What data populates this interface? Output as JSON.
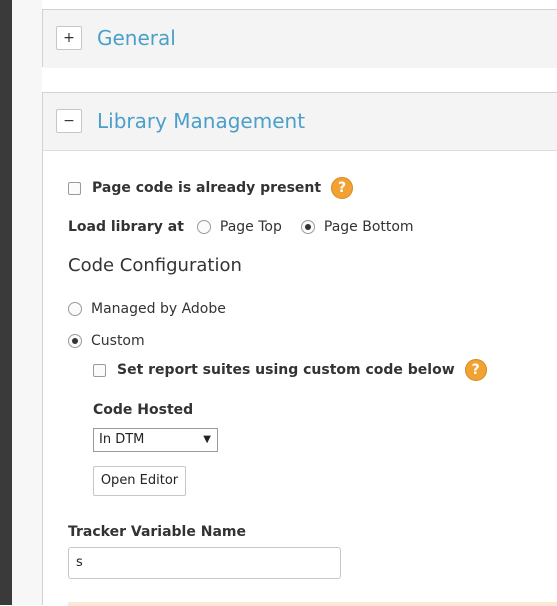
{
  "panels": {
    "general": {
      "toggle": "+",
      "title": "General"
    },
    "library": {
      "toggle": "−",
      "title": "Library Management"
    }
  },
  "page_code": {
    "label": "Page code is already present",
    "checked": false,
    "help": "?"
  },
  "load_library": {
    "label": "Load library at",
    "options": [
      {
        "label": "Page Top",
        "selected": false
      },
      {
        "label": "Page Bottom",
        "selected": true
      }
    ]
  },
  "code_configuration": {
    "title": "Code Configuration",
    "options": [
      {
        "label": "Managed by Adobe",
        "selected": false
      },
      {
        "label": "Custom",
        "selected": true
      }
    ],
    "report_suites": {
      "label": "Set report suites using custom code below",
      "checked": false,
      "help": "?"
    },
    "code_hosted": {
      "label": "Code Hosted",
      "value": "In DTM",
      "arrow": "▼"
    },
    "open_editor": "Open Editor"
  },
  "tracker": {
    "label": "Tracker Variable Name",
    "value": "s"
  },
  "colors": {
    "accent": "#4b9fc9",
    "help_icon": "#f1a233"
  }
}
